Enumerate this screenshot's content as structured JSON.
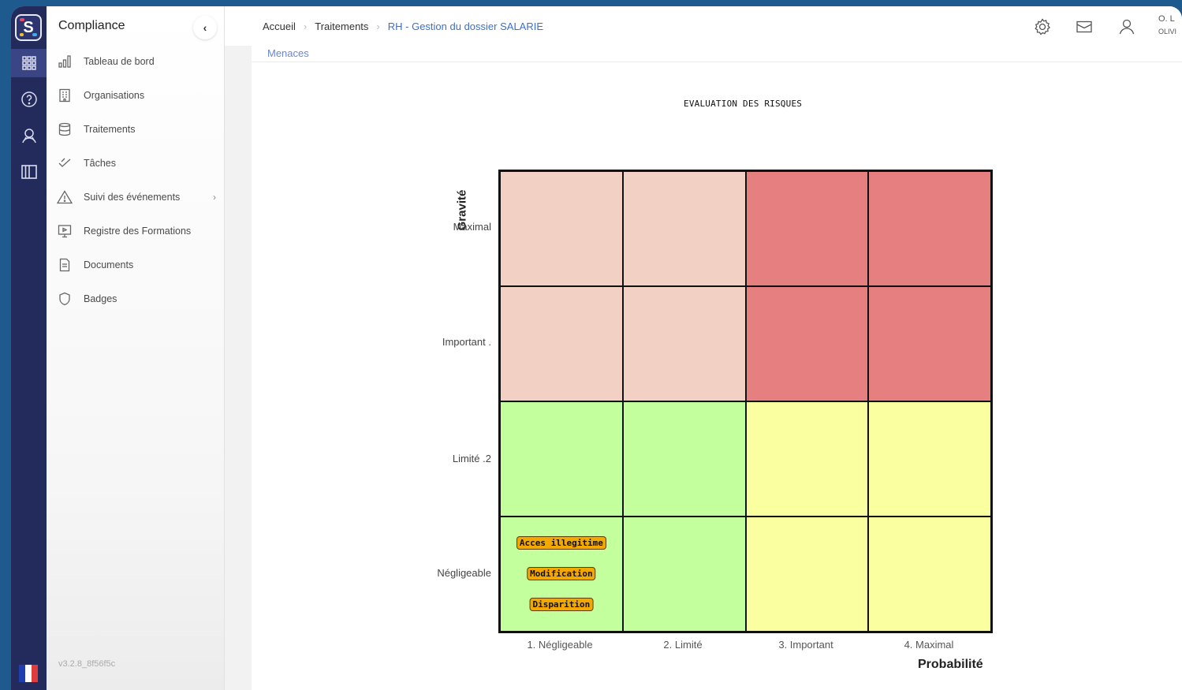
{
  "app": {
    "title": "Compliance",
    "version": "v3.2.8_8f56f5c",
    "logo_letter": "S"
  },
  "rail": {
    "items": [
      {
        "icon": "apps-grid-icon",
        "active": true
      },
      {
        "icon": "help-circle-icon",
        "active": false
      },
      {
        "icon": "user-icon",
        "active": false
      },
      {
        "icon": "book-icon",
        "active": false
      }
    ],
    "flag_colors": [
      "#1f3fb0",
      "#ffffff",
      "#e23b3b"
    ]
  },
  "sidebar": {
    "items": [
      {
        "label": "Tableau de bord",
        "icon": "bar-chart-icon"
      },
      {
        "label": "Organisations",
        "icon": "building-icon"
      },
      {
        "label": "Traitements",
        "icon": "database-icon"
      },
      {
        "label": "Tâches",
        "icon": "check-icon"
      },
      {
        "label": "Suivi des événements",
        "icon": "warning-icon",
        "has_submenu": true
      },
      {
        "label": "Registre des Formations",
        "icon": "presentation-icon"
      },
      {
        "label": "Documents",
        "icon": "document-icon"
      },
      {
        "label": "Badges",
        "icon": "shield-icon"
      }
    ]
  },
  "header": {
    "breadcrumb": [
      "Accueil",
      "Traitements",
      "RH - Gestion du dossier SALARIE"
    ],
    "user_initials": "O. L",
    "user_name": "OLIVI"
  },
  "section": {
    "tab_label": "Menaces"
  },
  "chart_data": {
    "type": "heatmap",
    "title": "EVALUATION DES RISQUES",
    "xlabel": "Probabilité",
    "ylabel": "Gravité",
    "x_categories": [
      "1. Négligeable",
      "2. Limité",
      "3. Important",
      "4. Maximal"
    ],
    "y_categories": [
      "1. Négligeable",
      "2. Limité",
      "3. Important",
      "4. Maximal"
    ],
    "y_tick_visible": [
      "Négligeable",
      "2. Limité",
      ". Important",
      "Maximal"
    ],
    "zones": [
      [
        "#c4ff9e",
        "#c4ff9e",
        "#faffa0",
        "#faffa0"
      ],
      [
        "#c4ff9e",
        "#c4ff9e",
        "#faffa0",
        "#faffa0"
      ],
      [
        "#f2d1c4",
        "#f2d1c4",
        "#e67f7f",
        "#e67f7f"
      ],
      [
        "#f2d1c4",
        "#f2d1c4",
        "#e67f7f",
        "#e67f7f"
      ]
    ],
    "risks": [
      {
        "label": "Acces illegitime",
        "x": 1,
        "y": 1
      },
      {
        "label": "Modification",
        "x": 1,
        "y": 1
      },
      {
        "label": "Disparition",
        "x": 1,
        "y": 1
      }
    ]
  }
}
